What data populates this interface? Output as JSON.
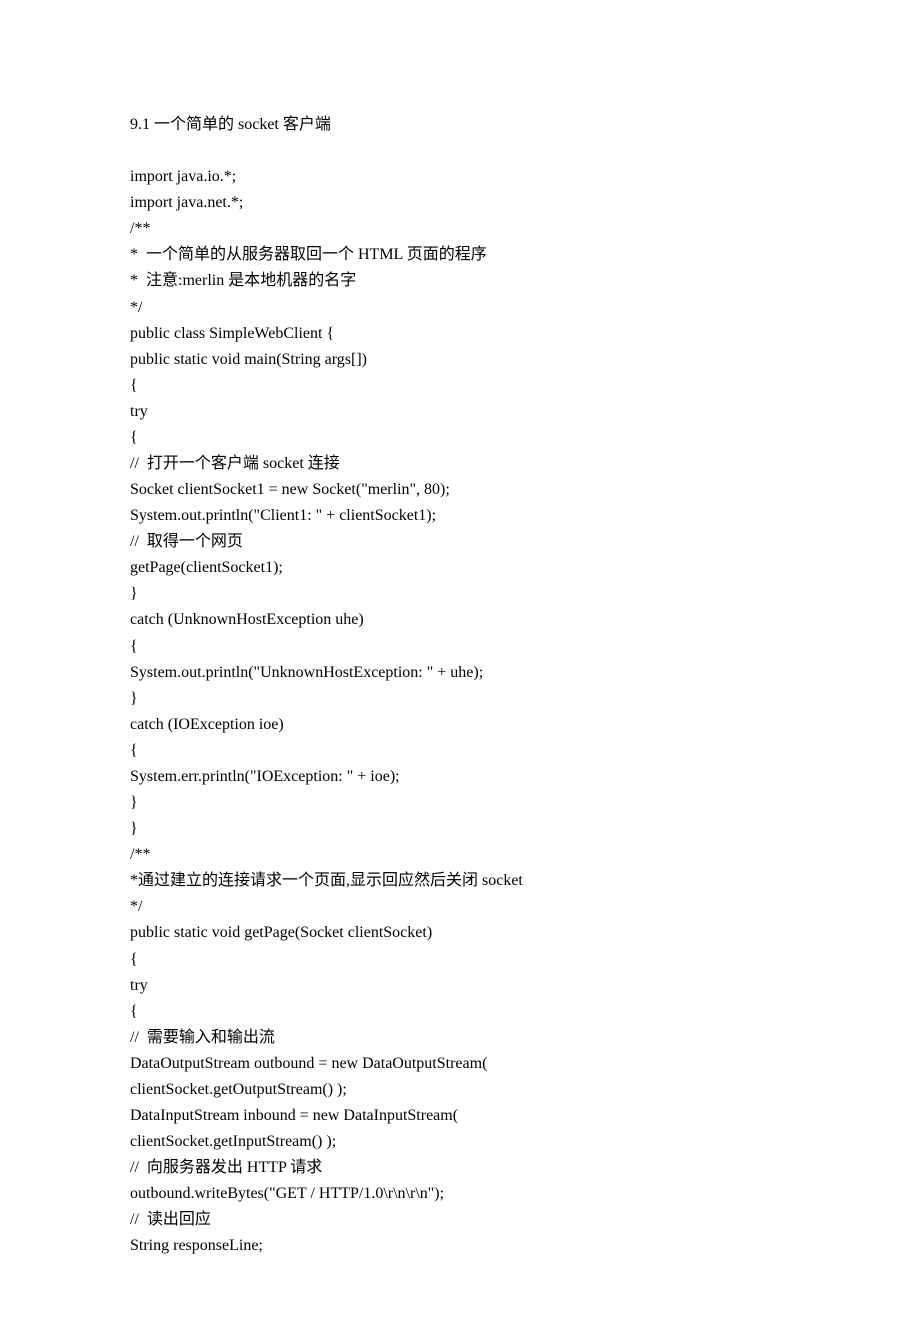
{
  "lines": [
    "9.1 一个简单的 socket 客户端",
    "",
    "import java.io.*;",
    "import java.net.*;",
    "/**",
    "*  一个简单的从服务器取回一个 HTML 页面的程序",
    "*  注意:merlin 是本地机器的名字",
    "*/",
    "public class SimpleWebClient {",
    "public static void main(String args[])",
    "{",
    "try",
    "{",
    "//  打开一个客户端 socket 连接",
    "Socket clientSocket1 = new Socket(\"merlin\", 80);",
    "System.out.println(\"Client1: \" + clientSocket1);",
    "//  取得一个网页",
    "getPage(clientSocket1);",
    "}",
    "catch (UnknownHostException uhe)",
    "{",
    "System.out.println(\"UnknownHostException: \" + uhe);",
    "}",
    "catch (IOException ioe)",
    "{",
    "System.err.println(\"IOException: \" + ioe);",
    "}",
    "}",
    "/**",
    "*通过建立的连接请求一个页面,显示回应然后关闭 socket",
    "*/",
    "public static void getPage(Socket clientSocket)",
    "{",
    "try",
    "{",
    "//  需要输入和输出流",
    "DataOutputStream outbound = new DataOutputStream(",
    "clientSocket.getOutputStream() );",
    "DataInputStream inbound = new DataInputStream(",
    "clientSocket.getInputStream() );",
    "//  向服务器发出 HTTP 请求",
    "outbound.writeBytes(\"GET / HTTP/1.0\\r\\n\\r\\n\");",
    "//  读出回应",
    "String responseLine;"
  ]
}
